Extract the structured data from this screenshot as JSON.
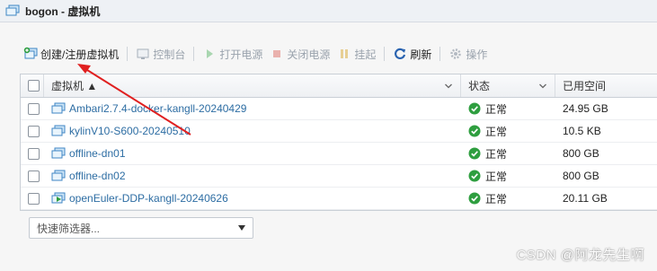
{
  "window": {
    "title": "bogon - 虚拟机"
  },
  "toolbar": {
    "create_label": "创建/注册虚拟机",
    "console_label": "控制台",
    "power_on_label": "打开电源",
    "power_off_label": "关闭电源",
    "suspend_label": "挂起",
    "refresh_label": "刷新",
    "actions_label": "操作"
  },
  "table": {
    "columns": [
      "虚拟机 ▲",
      "状态",
      "已用空间"
    ],
    "rows": [
      {
        "name": "Ambari2.7.4-docker-kangll-20240429",
        "state": "正常",
        "used": "24.95 GB",
        "powered": false
      },
      {
        "name": "kylinV10-S600-20240510",
        "state": "正常",
        "used": "10.5 KB",
        "powered": false
      },
      {
        "name": "offline-dn01",
        "state": "正常",
        "used": "800 GB",
        "powered": false
      },
      {
        "name": "offline-dn02",
        "state": "正常",
        "used": "800 GB",
        "powered": false
      },
      {
        "name": "openEuler-DDP-kangll-20240626",
        "state": "正常",
        "used": "20.11 GB",
        "powered": true
      }
    ]
  },
  "filter": {
    "placeholder": "快速筛选器..."
  },
  "watermark": "CSDN @阿龙先生啊",
  "colors": {
    "link": "#2d6da3",
    "ok_green": "#2e9e3f",
    "annotation_red": "#e02020"
  }
}
